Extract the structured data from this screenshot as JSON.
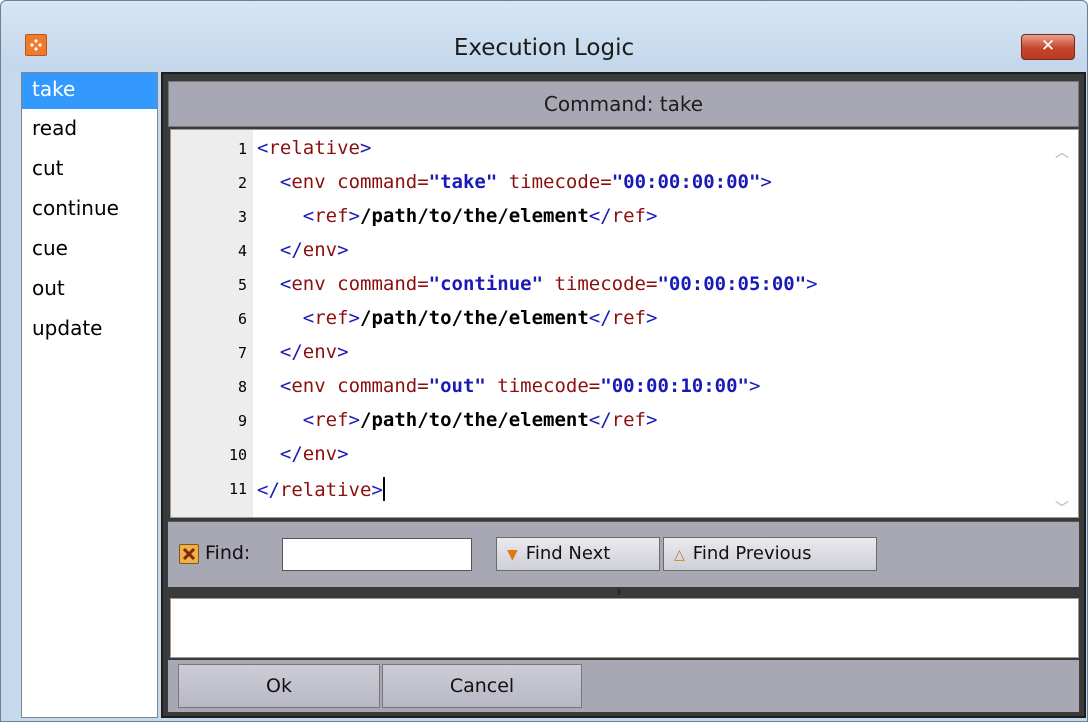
{
  "window": {
    "title": "Execution Logic",
    "close_label": "✕",
    "app_icon": "app-logo-icon"
  },
  "commands": [
    "take",
    "read",
    "cut",
    "continue",
    "cue",
    "out",
    "update"
  ],
  "selected_command": "take",
  "header": {
    "label": "Command: take"
  },
  "editor": {
    "line_numbers": [
      "1",
      "2",
      "3",
      "4",
      "5",
      "6",
      "7",
      "8",
      "9",
      "10",
      "11"
    ]
  },
  "find": {
    "label": "Find:",
    "value": "",
    "next_label": "Find Next",
    "prev_label": "Find Previous"
  },
  "footer": {
    "ok_label": "Ok",
    "cancel_label": "Cancel"
  },
  "colors": {
    "selection": "#3399ff",
    "tag": "#1a1ab8",
    "attribute": "#8b0f0f",
    "frame": "#3a3a3a",
    "panel": "#a8a8b4"
  }
}
